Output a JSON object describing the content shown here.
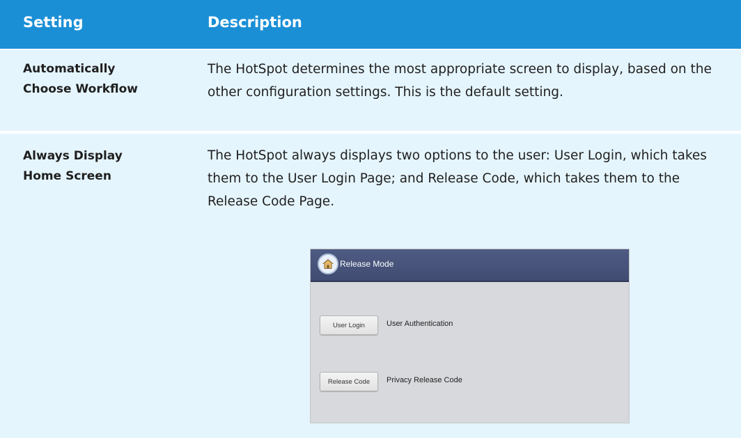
{
  "header": {
    "setting_label": "Setting",
    "description_label": "Description"
  },
  "rows": [
    {
      "setting_line1": "Automatically",
      "setting_line2": "Choose Workflow",
      "description": "The HotSpot determines the most appropriate screen to display, based on the other configuration settings. This is the default setting."
    },
    {
      "setting_line1": "Always Display",
      "setting_line2": "Home Screen",
      "description": "The HotSpot always displays two options to the user: User Login, which takes them to the User Login Page; and Release Code, which takes them to the Release Code Page."
    }
  ],
  "screenshot": {
    "title": "Release Mode",
    "home_icon": "home-icon",
    "user_login_button": "User Login",
    "user_login_label": "User Authentication",
    "release_code_button": "Release Code",
    "release_code_label": "Privacy Release Code"
  },
  "colors": {
    "header_bg": "#1b8fd6",
    "row_bg": "#e5f5fd",
    "screenshot_bar": "#4a567d",
    "screenshot_bg": "#d7d9dc"
  }
}
